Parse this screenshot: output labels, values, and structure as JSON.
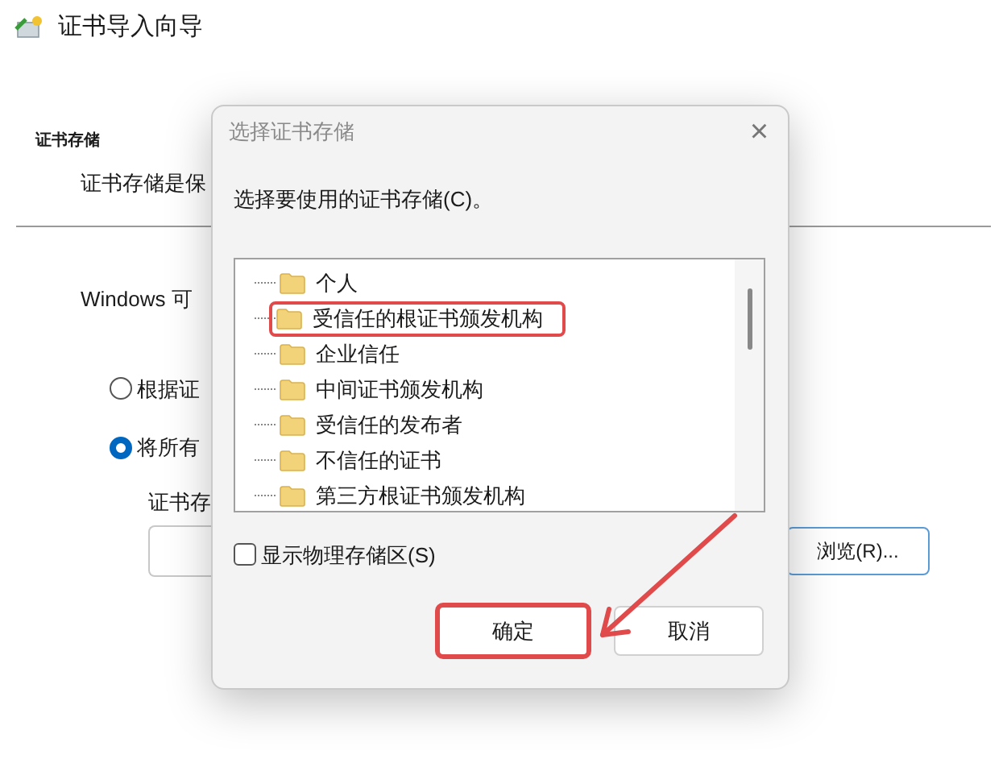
{
  "wizard": {
    "title": "证书导入向导",
    "section_title": "证书存储",
    "section_description": "证书存储是保",
    "intro": "Windows 可",
    "options": [
      {
        "label": "根据证",
        "selected": false
      },
      {
        "label": "将所有",
        "selected": true
      }
    ],
    "store_label": "证书存",
    "browse_button": "浏览(R)..."
  },
  "dialog": {
    "title": "选择证书存储",
    "close": "×",
    "prompt": "选择要使用的证书存储(C)。",
    "stores": [
      {
        "label": "个人",
        "highlighted": false
      },
      {
        "label": "受信任的根证书颁发机构",
        "highlighted": true
      },
      {
        "label": "企业信任",
        "highlighted": false
      },
      {
        "label": "中间证书颁发机构",
        "highlighted": false
      },
      {
        "label": "受信任的发布者",
        "highlighted": false
      },
      {
        "label": "不信任的证书",
        "highlighted": false
      },
      {
        "label": "第三方根证书颁发机构",
        "highlighted": false
      }
    ],
    "show_physical": {
      "label": "显示物理存储区(S)",
      "checked": false
    },
    "buttons": [
      {
        "label": "确定",
        "highlighted": true
      },
      {
        "label": "取消",
        "highlighted": false
      }
    ]
  }
}
